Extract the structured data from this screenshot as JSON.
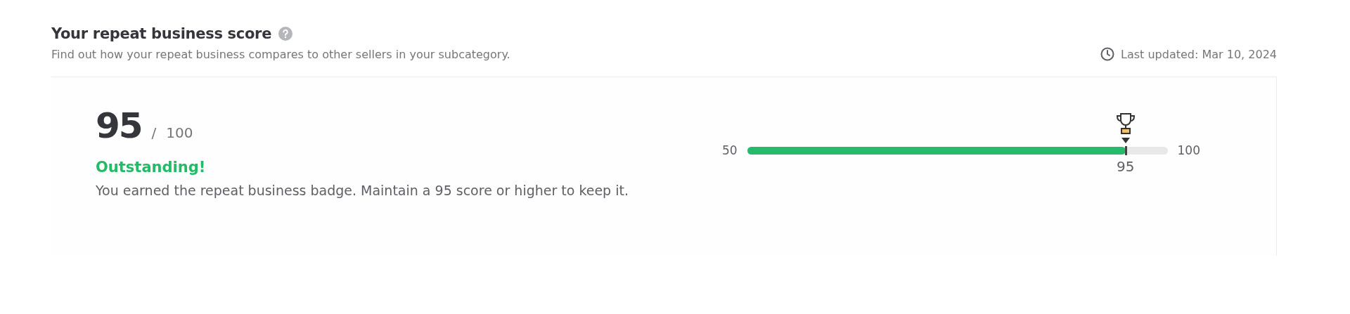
{
  "header": {
    "title": "Your repeat business score",
    "subtitle": "Find out how your repeat business compares to other sellers in your subcategory.",
    "last_updated": "Last updated: Mar 10, 2024"
  },
  "score": {
    "value": "95",
    "separator": "/",
    "max": "100",
    "rating": "Outstanding!",
    "message": "You earned the repeat business badge. Maintain a 95 score or higher to keep it."
  },
  "meter": {
    "min_label": "50",
    "max_label": "100",
    "level": 0.9,
    "marker_label": "95"
  }
}
